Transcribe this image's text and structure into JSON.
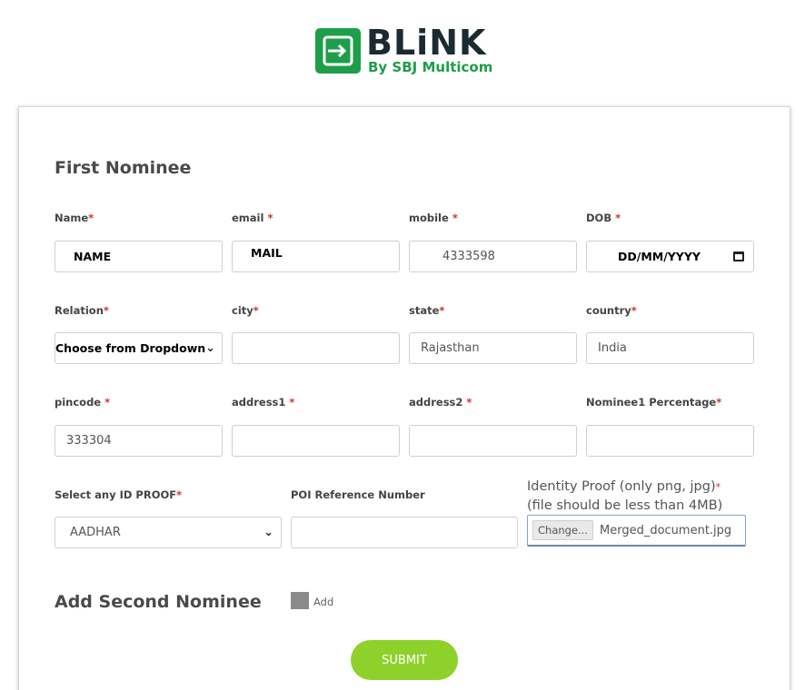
{
  "brand": {
    "name": "BLiNK",
    "sub": "By SBJ Multicom",
    "color": "#1f9e4a"
  },
  "first_nominee": {
    "title": "First Nominee",
    "name": {
      "label": "Name",
      "value": "NAME"
    },
    "email": {
      "label": "email",
      "value": "MAIL"
    },
    "mobile": {
      "label": "mobile",
      "value": "4333598"
    },
    "dob": {
      "label": "DOB",
      "value": "DD/MM/YYYY"
    },
    "relation": {
      "label": "Relation",
      "value": "Choose from Dropdown"
    },
    "city": {
      "label": "city",
      "value": ""
    },
    "state": {
      "label": "state",
      "value": "Rajasthan"
    },
    "country": {
      "label": "country",
      "value": "India"
    },
    "pincode": {
      "label": "pincode",
      "value": "333304"
    },
    "address1": {
      "label": "address1",
      "value": ""
    },
    "address2": {
      "label": "address2",
      "value": ""
    },
    "percentage": {
      "label": "Nominee1 Percentage",
      "value": ""
    },
    "id_proof": {
      "label": "Select any ID PROOF",
      "value": "AADHAR"
    },
    "poi_ref": {
      "label": "POI Reference Number",
      "value": ""
    },
    "identity_file": {
      "label": "Identity Proof (only png, jpg)",
      "note": "(file should be less than 4MB)",
      "button": "Change...",
      "filename": "Merged_document.jpg"
    }
  },
  "second_nominee": {
    "title": "Add Second Nominee",
    "checkbox_label": "Add"
  },
  "submit_label": "SUBMIT",
  "required_mark": "*"
}
